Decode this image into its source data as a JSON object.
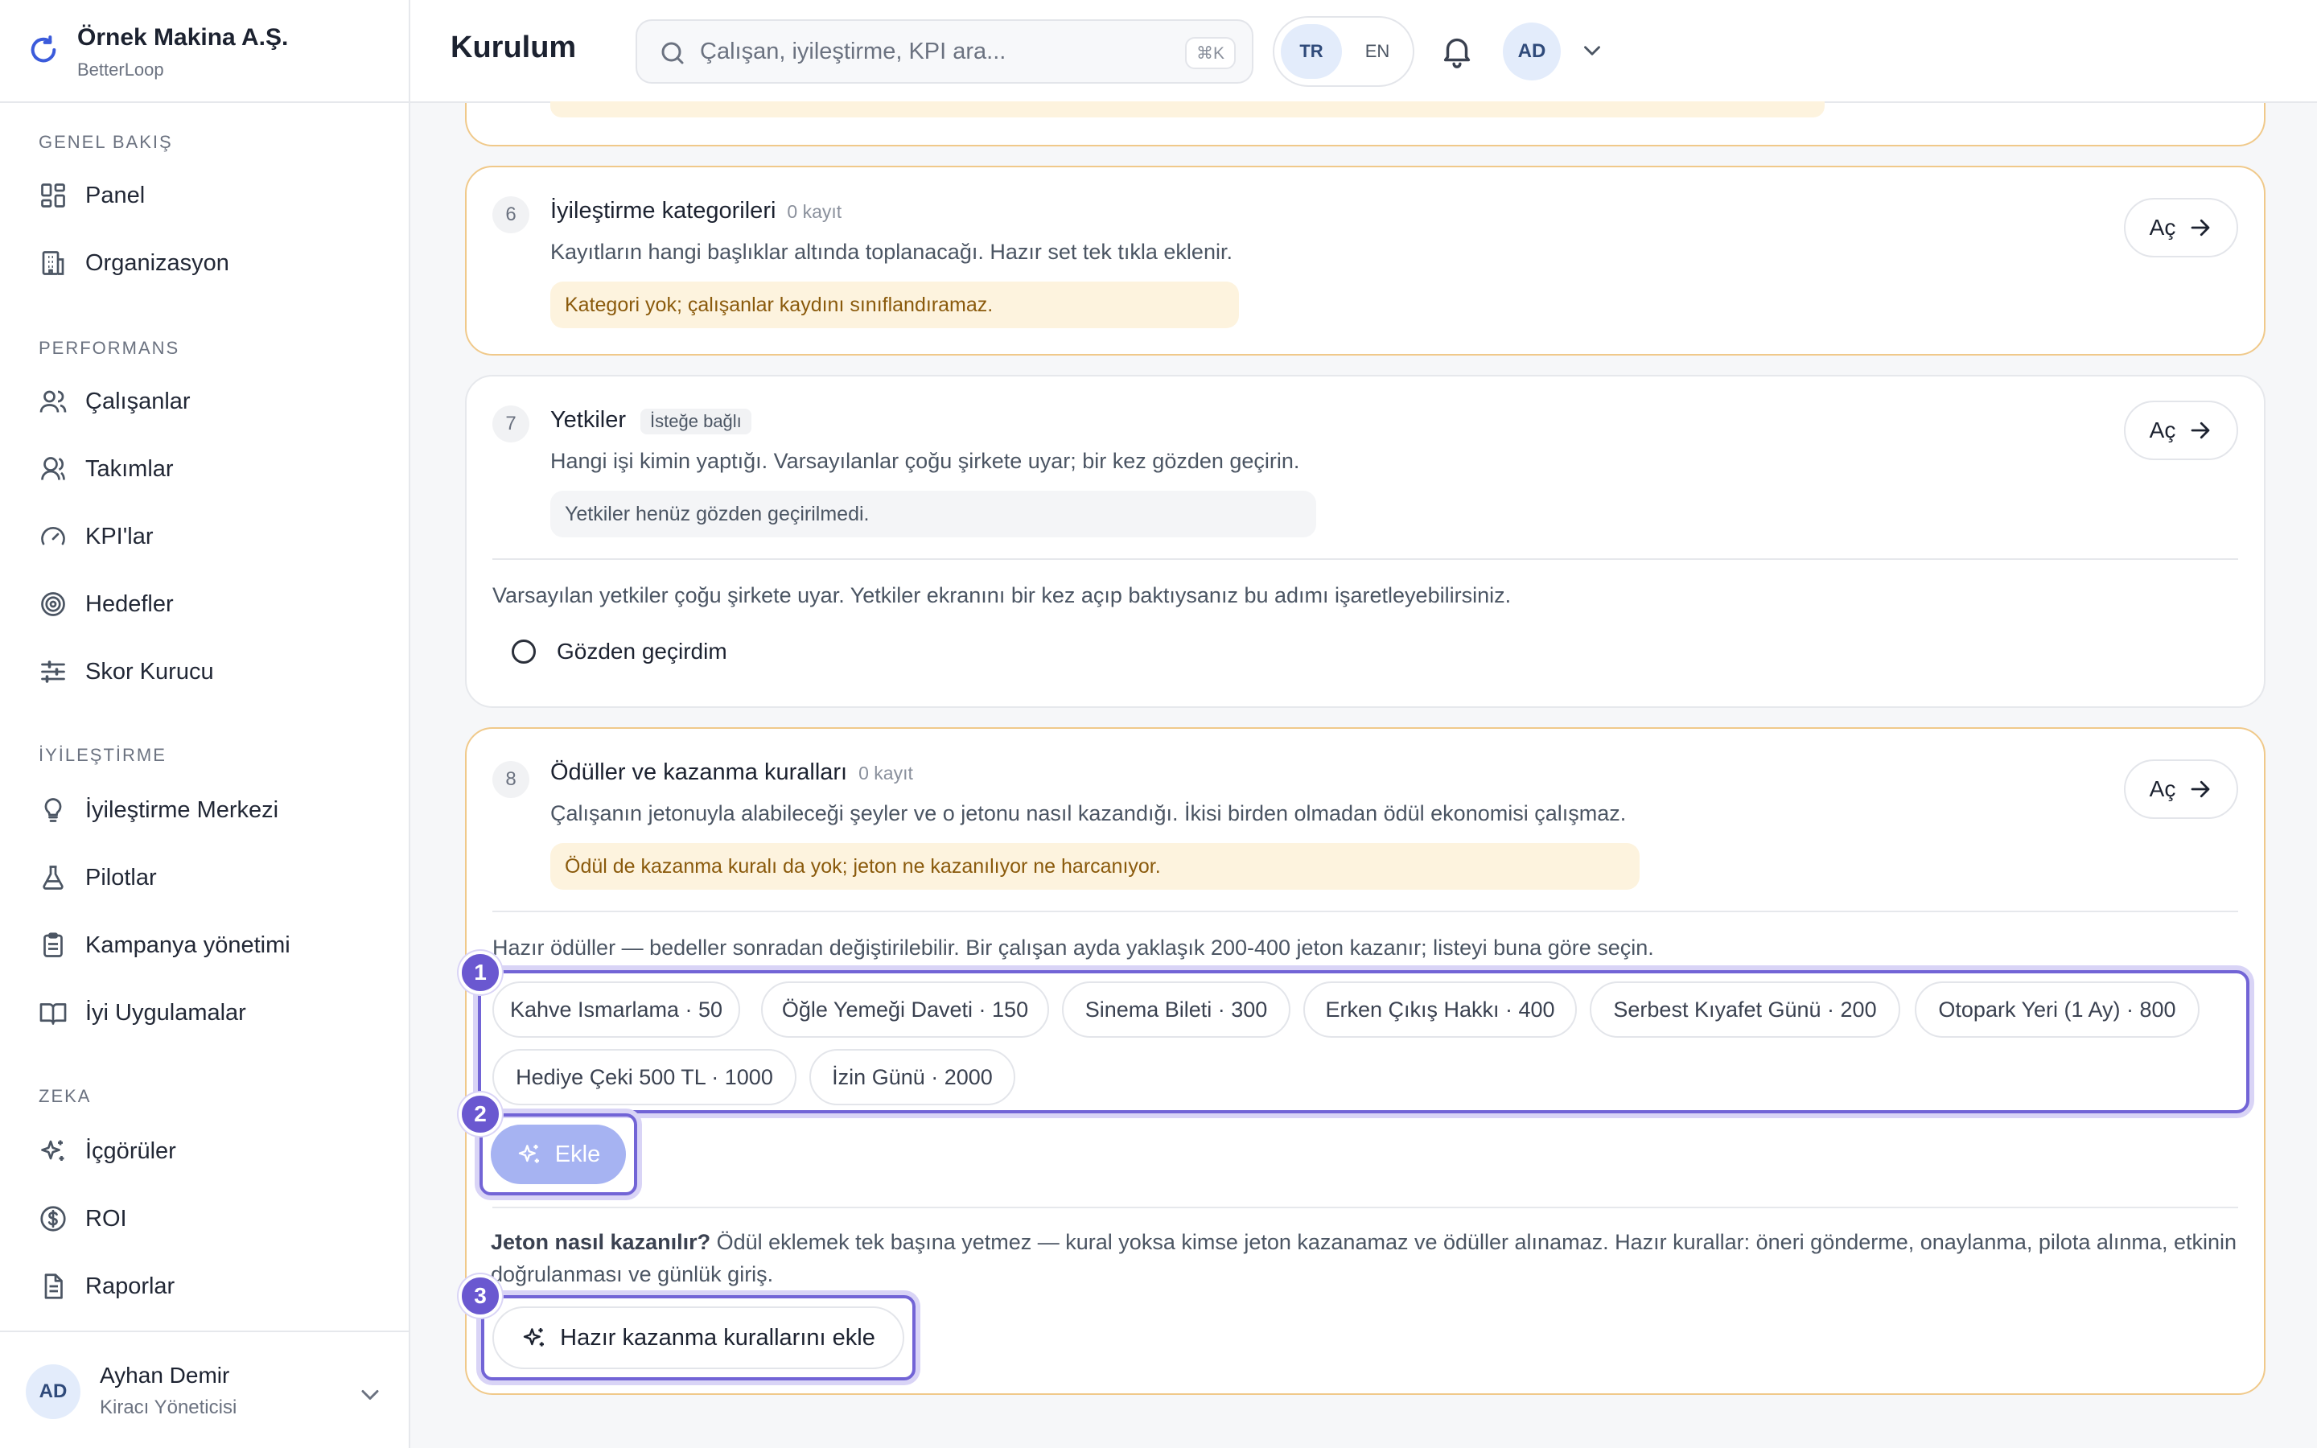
{
  "brand": {
    "name": "Örnek Makina A.Ş.",
    "sub": "BetterLoop"
  },
  "nav": {
    "groups": [
      {
        "label": "GENEL BAKIŞ"
      },
      {
        "label": "PERFORMANS"
      },
      {
        "label": "İYİLEŞTİRME"
      },
      {
        "label": "ZEKA"
      }
    ],
    "items": [
      {
        "label": "Panel",
        "icon": "dashboard-icon"
      },
      {
        "label": "Organizasyon",
        "icon": "building-icon"
      },
      {
        "label": "Çalışanlar",
        "icon": "users-icon"
      },
      {
        "label": "Takımlar",
        "icon": "team-icon"
      },
      {
        "label": "KPI'lar",
        "icon": "gauge-icon"
      },
      {
        "label": "Hedefler",
        "icon": "target-icon"
      },
      {
        "label": "Skor Kurucu",
        "icon": "sliders-icon"
      },
      {
        "label": "İyileştirme Merkezi",
        "icon": "lightbulb-icon"
      },
      {
        "label": "Pilotlar",
        "icon": "flask-icon"
      },
      {
        "label": "Kampanya yönetimi",
        "icon": "clipboard-icon"
      },
      {
        "label": "İyi Uygulamalar",
        "icon": "book-icon"
      },
      {
        "label": "İçgörüler",
        "icon": "sparkles-icon"
      },
      {
        "label": "ROI",
        "icon": "dollar-icon"
      },
      {
        "label": "Raporlar",
        "icon": "document-icon"
      }
    ]
  },
  "user": {
    "initials": "AD",
    "name": "Ayhan Demir",
    "role": "Kiracı Yöneticisi"
  },
  "header": {
    "title": "Kurulum",
    "search_placeholder": "Çalışan, iyileştirme, KPI ara...",
    "search_shortcut": "⌘K",
    "lang_tr": "TR",
    "lang_en": "EN",
    "avatar": "AD"
  },
  "steps": [
    {
      "num": "6",
      "title": "İyileştirme kategorileri",
      "meta": "0 kayıt",
      "desc": "Kayıtların hangi başlıklar altında toplanacağı. Hazır set tek tıkla eklenir.",
      "notice": "Kategori yok; çalışanlar kaydını sınıflandıramaz.",
      "open": "Aç"
    },
    {
      "num": "7",
      "title": "Yetkiler",
      "tag": "İsteğe bağlı",
      "desc": "Hangi işi kimin yaptığı. Varsayılanlar çoğu şirkete uyar; bir kez gözden geçirin.",
      "notice": "Yetkiler henüz gözden geçirilmedi.",
      "open": "Aç",
      "body": "Varsayılan yetkiler çoğu şirkete uyar. Yetkiler ekranını bir kez açıp baktıysanız bu adımı işaretleyebilirsiniz.",
      "checkbox": "Gözden geçirdim"
    },
    {
      "num": "8",
      "title": "Ödüller ve kazanma kuralları",
      "meta": "0 kayıt",
      "desc": "Çalışanın jetonuyla alabileceği şeyler ve o jetonu nasıl kazandığı. İkisi birden olmadan ödül ekonomisi çalışmaz.",
      "notice": "Ödül de kazanma kuralı da yok; jeton ne kazanılıyor ne harcanıyor.",
      "open": "Aç",
      "presets_intro": "Hazır ödüller — bedeller sonradan değiştirilebilir. Bir çalışan ayda yaklaşık 200-400 jeton kazanır; listeyi buna göre seçin.",
      "chips": [
        "Kahve Ismarlama · 50",
        "Öğle Yemeği Daveti · 150",
        "Sinema Bileti · 300",
        "Erken Çıkış Hakkı · 400",
        "Serbest Kıyafet Günü · 200",
        "Otopark Yeri (1 Ay) · 800",
        "Hediye Çeki 500 TL · 1000",
        "İzin Günü · 2000"
      ],
      "add_button": "Ekle",
      "earn_title": "Jeton nasıl kazanılır?",
      "earn_text": " Ödül eklemek tek başına yetmez — kural yoksa kimse jeton kazanamaz ve ödüller alınamaz. Hazır kurallar: öneri gönderme, onaylanma, pilota alınma, etkinin doğrulanması ve günlük giriş.",
      "rules_button": "Hazır kazanma kurallarını ekle"
    }
  ],
  "markers": [
    "1",
    "2",
    "3"
  ],
  "colors": {
    "accent": "#6a58d0",
    "warn_border": "#f0c98a",
    "warn_bg": "#fdf3de"
  }
}
